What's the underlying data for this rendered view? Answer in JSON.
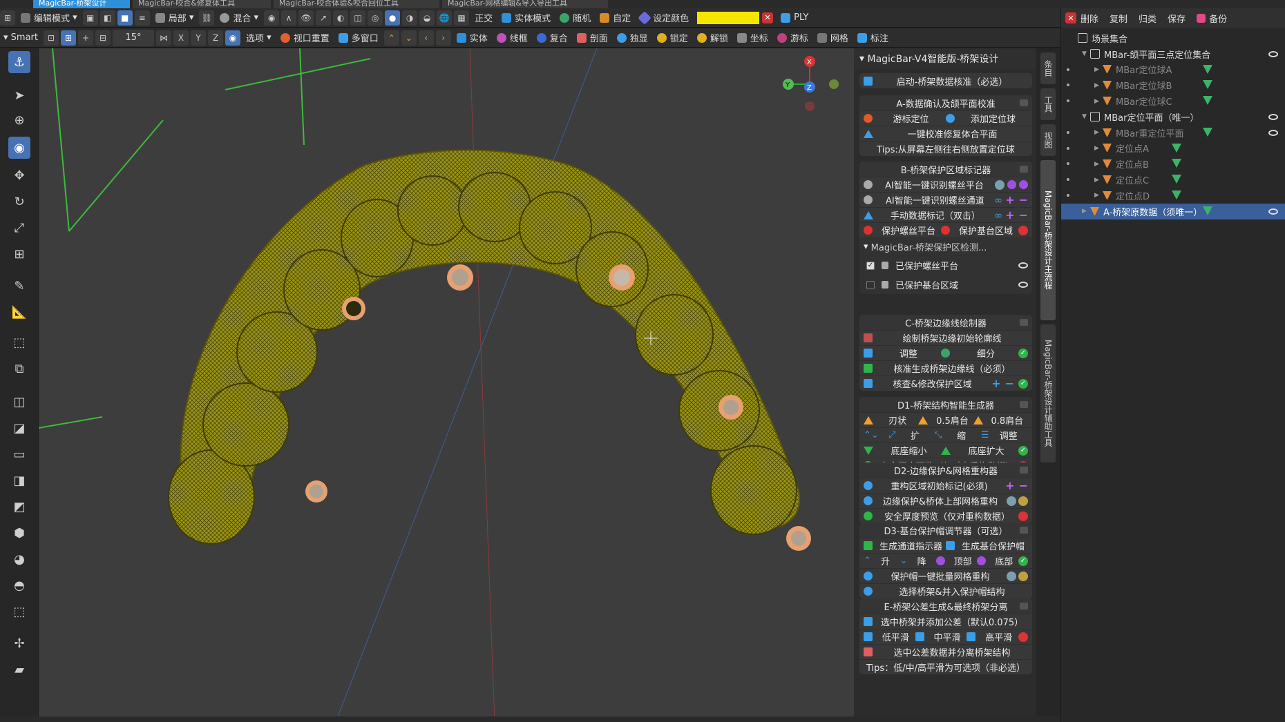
{
  "tabs": [
    "MagicBar-桥架设计",
    "MagicBar-咬合&修复体工具",
    "MagicBar-咬合体验&咬合回位工具",
    "MagicBar-网格编辑&导入导出工具"
  ],
  "toolbar1": {
    "mode": "编辑模式",
    "local": "局部",
    "mix": "混合",
    "ortho": "正交",
    "solid_mode": "实体模式",
    "random": "随机",
    "custom": "自定",
    "set_color": "设定颜色",
    "ply": "PLY",
    "swatch": "#f5e600"
  },
  "toolbar2": {
    "smart": "Smart",
    "angle": "15°",
    "axes": [
      "X",
      "Y",
      "Z"
    ],
    "options": "选项",
    "view_reset": "视口重置",
    "multi_window": "多窗口",
    "solid": "实体",
    "wire": "线框",
    "composite": "复合",
    "section": "剖面",
    "solo": "独显",
    "lock": "锁定",
    "unlock": "解锁",
    "coord": "坐标",
    "cursor": "游标",
    "grid": "网格",
    "annot": "标注"
  },
  "gizmo": {
    "x": "X",
    "y": "Y",
    "z": "Z"
  },
  "vtabs": [
    "条目",
    "工具",
    "视图",
    "MagicBar-桥架设计主流程",
    "MagicBar-桥架设计辅助工具"
  ],
  "panel": {
    "title": "MagicBar-V4智能版-桥架设计",
    "start": "启动-桥架数据核准（必选）",
    "secA": {
      "title": "A-数据确认及颌平面校准",
      "r1a": "游标定位",
      "r1b": "添加定位球",
      "r2": "一键校准修复体合平面",
      "r3": "Tips:从屏幕左侧往右侧放置定位球"
    },
    "secB": {
      "title": "B-桥架保护区域标记器",
      "r1": "AI智能一键识别螺丝平台",
      "r2": "AI智能一键识别螺丝通道",
      "r3": "手动数据标记（双击）",
      "r4a": "保护螺丝平台",
      "r4b": "保护基台区域",
      "sub": "MagicBar-桥架保护区检测...",
      "c1": "已保护螺丝平台",
      "c2": "已保护基台区域"
    },
    "secC": {
      "title": "C-桥架边缘线绘制器",
      "r1": "绘制桥架边缘初始轮廓线",
      "r2a": "调整",
      "r2b": "细分",
      "r3": "核准生成桥架边缘线（必须）",
      "r4": "核查&修改保护区域"
    },
    "secD1": {
      "title": "D1-桥架结构智能生成器",
      "r1a": "刃状",
      "r1b": "0.5肩台",
      "r1c": "0.8肩台",
      "r2a": "扩",
      "r2b": "缩",
      "r2c": "调整",
      "r3a": "底座缩小",
      "r3b": "底座扩大",
      "r4": "安全厚度预览（仅对未重构数据）"
    },
    "secD2": {
      "title": "D2-边缘保护&网格重构器",
      "r1": "重构区域初始标记(必须)",
      "r2": "边缘保护&桥体上部网格重构",
      "r3": "安全厚度预览（仅对重构数据）"
    },
    "secD3": {
      "title": "D3-基台保护帽调节器（可选）",
      "r1a": "生成通道指示器",
      "r1b": "生成基台保护帽",
      "r2a": "升",
      "r2b": "降",
      "r2c": "顶部",
      "r2d": "底部",
      "r3": "保护帽一键批量网格重构",
      "r4": "选择桥架&并入保护帽结构"
    },
    "secE": {
      "title": "E-桥架公差生成&最终桥架分离",
      "r1": "选中桥架并添加公差（默认0.075）",
      "r2a": "低平滑",
      "r2b": "中平滑",
      "r2c": "高平滑",
      "r3": "选中公差数据并分离桥架结构",
      "r4": "Tips：低/中/高平滑为可选项（非必选）"
    }
  },
  "outliner": {
    "header": {
      "del": "删除",
      "copy": "复制",
      "classify": "归类",
      "save": "保存",
      "backup": "备份"
    },
    "rows": [
      {
        "label": "场景集合",
        "level": 0
      },
      {
        "label": "MBar-颌平面三点定位集合",
        "level": 1
      },
      {
        "label": "MBar定位球A",
        "level": 2
      },
      {
        "label": "MBar定位球B",
        "level": 2
      },
      {
        "label": "MBar定位球C",
        "level": 2
      },
      {
        "label": "MBar定位平面（唯一）",
        "level": 1
      },
      {
        "label": "MBar重定位平面",
        "level": 2
      },
      {
        "label": "定位点A",
        "level": 2
      },
      {
        "label": "定位点B",
        "level": 2
      },
      {
        "label": "定位点C",
        "level": 2
      },
      {
        "label": "定位点D",
        "level": 2
      },
      {
        "label": "A-桥架原数据（须唯一）",
        "level": 1
      }
    ]
  },
  "colors": {
    "accent": "#4772b3",
    "model": "#8f8a16",
    "ring": "#e8a070",
    "selected": "#3a5f9a"
  }
}
